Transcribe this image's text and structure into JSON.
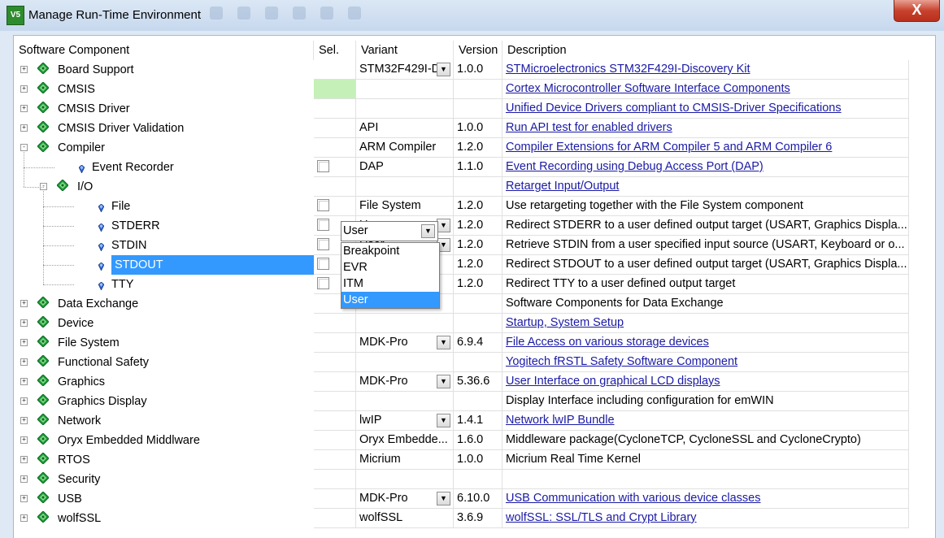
{
  "window": {
    "title": "Manage Run-Time Environment",
    "app_icon_label": "V5",
    "close_label": "X"
  },
  "columns": {
    "component": "Software Component",
    "sel": "Sel.",
    "variant": "Variant",
    "version": "Version",
    "description": "Description"
  },
  "rows": [
    {
      "name": "Board Support",
      "level": 0,
      "expander": "+",
      "icon": "diamond-icon",
      "variant": "STM32F429I-D",
      "variant_dropdown": true,
      "version": "1.0.0",
      "description": "STMicroelectronics STM32F429I-Discovery Kit",
      "link": true
    },
    {
      "name": "CMSIS",
      "level": 0,
      "expander": "+",
      "icon": "diamond-icon",
      "sel_state": "green",
      "description": "Cortex Microcontroller Software Interface Components",
      "link": true
    },
    {
      "name": "CMSIS Driver",
      "level": 0,
      "expander": "+",
      "icon": "diamond-icon",
      "description": "Unified Device Drivers compliant to CMSIS-Driver Specifications",
      "link": true
    },
    {
      "name": "CMSIS Driver Validation",
      "level": 0,
      "expander": "+",
      "icon": "diamond-icon",
      "variant": "API",
      "version": "1.0.0",
      "description": "Run API test for enabled drivers",
      "link": true
    },
    {
      "name": "Compiler",
      "level": 0,
      "expander": "-",
      "icon": "diamond-icon",
      "variant": "ARM Compiler",
      "version": "1.2.0",
      "description": "Compiler Extensions for ARM Compiler 5 and ARM Compiler 6",
      "link": true
    },
    {
      "name": "Event Recorder",
      "level": 1,
      "icon": "gem-icon",
      "checkbox": true,
      "variant": "DAP",
      "version": "1.1.0",
      "description": "Event Recording using Debug Access Port (DAP)",
      "link": true
    },
    {
      "name": "I/O",
      "level": 1,
      "expander": "-",
      "icon": "diamond-icon",
      "description": "Retarget Input/Output",
      "link": true
    },
    {
      "name": "File",
      "level": 2,
      "icon": "gem-icon",
      "checkbox": true,
      "variant": "File System",
      "version": "1.2.0",
      "description": "Use retargeting together with the File System component",
      "link": false
    },
    {
      "name": "STDERR",
      "level": 2,
      "icon": "gem-icon",
      "checkbox": true,
      "variant": "User",
      "variant_dropdown": true,
      "version": "1.2.0",
      "description": "Redirect STDERR to a user defined output target (USART, Graphics Displa...",
      "link": false
    },
    {
      "name": "STDIN",
      "level": 2,
      "icon": "gem-icon",
      "checkbox": true,
      "variant": "User",
      "variant_dropdown": true,
      "version": "1.2.0",
      "description": "Retrieve STDIN from a user specified input source  (USART, Keyboard or o...",
      "link": false
    },
    {
      "name": "STDOUT",
      "level": 2,
      "icon": "gem-icon",
      "checkbox": true,
      "selected": true,
      "variant": "User",
      "variant_dropdown": true,
      "variant_open": true,
      "version": "1.2.0",
      "description": "Redirect STDOUT to a user defined output target (USART, Graphics Displa...",
      "link": false
    },
    {
      "name": "TTY",
      "level": 2,
      "icon": "gem-icon",
      "checkbox": true,
      "version": "1.2.0",
      "description": "Redirect TTY to a user defined output target",
      "link": false
    },
    {
      "name": "Data Exchange",
      "level": 0,
      "expander": "+",
      "icon": "diamond-icon",
      "description": "Software Components for Data Exchange",
      "link": false
    },
    {
      "name": "Device",
      "level": 0,
      "expander": "+",
      "icon": "diamond-icon",
      "description": "Startup, System Setup",
      "link": true
    },
    {
      "name": "File System",
      "level": 0,
      "expander": "+",
      "icon": "diamond-icon",
      "variant": "MDK-Pro",
      "variant_dropdown": true,
      "version": "6.9.4",
      "description": "File Access on various storage devices",
      "link": true
    },
    {
      "name": "Functional Safety",
      "level": 0,
      "expander": "+",
      "icon": "diamond-icon",
      "description": "Yogitech fRSTL Safety Software Component",
      "link": true
    },
    {
      "name": "Graphics",
      "level": 0,
      "expander": "+",
      "icon": "diamond-icon",
      "variant": "MDK-Pro",
      "variant_dropdown": true,
      "version": "5.36.6",
      "description": "User Interface on graphical LCD displays",
      "link": true
    },
    {
      "name": "Graphics Display",
      "level": 0,
      "expander": "+",
      "icon": "diamond-icon",
      "description": "Display Interface including configuration for emWIN",
      "link": false
    },
    {
      "name": "Network",
      "level": 0,
      "expander": "+",
      "icon": "diamond-icon",
      "variant": "lwIP",
      "variant_dropdown": true,
      "version": "1.4.1",
      "description": "Network lwIP Bundle",
      "link": true
    },
    {
      "name": "Oryx Embedded Middlware",
      "level": 0,
      "expander": "+",
      "icon": "diamond-icon",
      "variant": "Oryx Embedde...",
      "version": "1.6.0",
      "description": "Middleware package(CycloneTCP, CycloneSSL and CycloneCrypto)",
      "link": false
    },
    {
      "name": "RTOS",
      "level": 0,
      "expander": "+",
      "icon": "diamond-icon",
      "variant": "Micrium",
      "version": "1.0.0",
      "description": "Micrium Real Time Kernel",
      "link": false
    },
    {
      "name": "Security",
      "level": 0,
      "expander": "+",
      "icon": "diamond-icon",
      "description": "",
      "link": false
    },
    {
      "name": "USB",
      "level": 0,
      "expander": "+",
      "icon": "diamond-icon",
      "variant": "MDK-Pro",
      "variant_dropdown": true,
      "version": "6.10.0",
      "description": "USB Communication with various device classes",
      "link": true
    },
    {
      "name": "wolfSSL",
      "level": 0,
      "expander": "+",
      "icon": "diamond-icon",
      "variant": "wolfSSL",
      "version": "3.6.9",
      "description": "wolfSSL: SSL/TLS and Crypt Library",
      "link": true
    }
  ],
  "variant_popup": {
    "current": "User",
    "options": [
      "Breakpoint",
      "EVR",
      "ITM",
      "User"
    ],
    "selected": "User"
  },
  "colors": {
    "selection": "#3399ff",
    "link": "#1a1aa6",
    "sel_green": "#c5f0b8",
    "diamond": "#1e9e3a"
  }
}
